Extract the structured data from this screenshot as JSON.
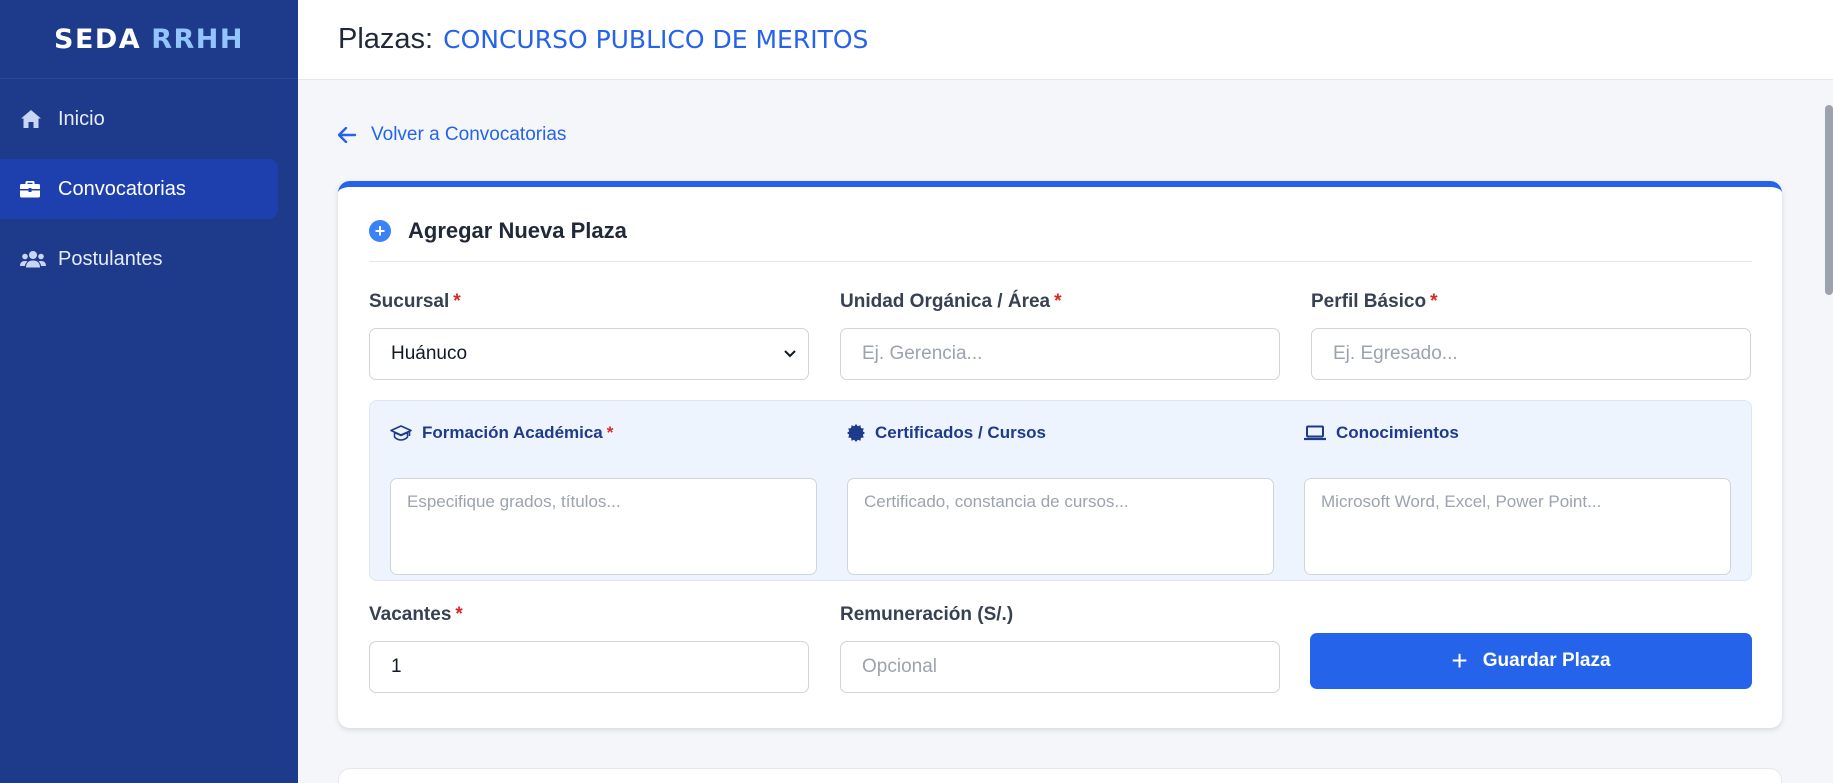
{
  "brand": {
    "name": "SEDA",
    "accent": "RRHH"
  },
  "sidebar": {
    "items": [
      {
        "label": "Inicio",
        "icon": "home-icon",
        "active": false
      },
      {
        "label": "Convocatorias",
        "icon": "briefcase-icon",
        "active": true
      },
      {
        "label": "Postulantes",
        "icon": "users-icon",
        "active": false
      }
    ]
  },
  "header": {
    "label": "Plazas:",
    "value": "CONCURSO PUBLICO DE MERITOS"
  },
  "back_link": "Volver a Convocatorias",
  "form": {
    "title": "Agregar Nueva Plaza",
    "required_mark": "*",
    "sucursal": {
      "label": "Sucursal",
      "value": "Huánuco"
    },
    "unidad": {
      "label": "Unidad Orgánica / Área",
      "placeholder": "Ej. Gerencia..."
    },
    "perfil": {
      "label": "Perfil Básico",
      "placeholder": "Ej. Egresado..."
    },
    "formacion": {
      "label": "Formación Académica",
      "placeholder": "Especifique grados, títulos..."
    },
    "certificados": {
      "label": "Certificados / Cursos",
      "placeholder": "Certificado, constancia de cursos..."
    },
    "conocimientos": {
      "label": "Conocimientos",
      "placeholder": "Microsoft Word, Excel, Power Point..."
    },
    "vacantes": {
      "label": "Vacantes",
      "value": "1"
    },
    "remuneracion": {
      "label": "Remuneración (S/.)",
      "placeholder": "Opcional"
    },
    "save_label": "Guardar Plaza"
  },
  "colors": {
    "sidebar": "#1e3a8a",
    "accent": "#2563eb",
    "required": "#dc2626"
  }
}
